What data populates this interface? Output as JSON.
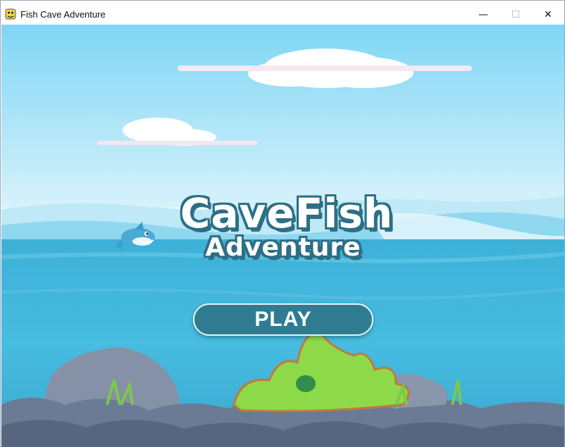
{
  "window": {
    "title": "Fish Cave Adventure",
    "icon": "pygame-snake-icon",
    "controls": {
      "minimize": "—",
      "maximize": "☐",
      "close": "✕"
    }
  },
  "game": {
    "logo": {
      "line1": "CaveFish",
      "line2": "Adventure"
    },
    "play_button": {
      "label": "PLAY"
    },
    "colors": {
      "sky_top": "#7fd6f5",
      "sky_bottom": "#cdeefa",
      "sea": "#3fb4da",
      "logo_outline": "#2d6f86",
      "button_fill": "#2f7c92",
      "rocks": "#6b7a95",
      "seaweed": "#8ed94a"
    },
    "sprites": [
      "shark-mascot",
      "cloud",
      "rock-reef",
      "green-coral"
    ]
  }
}
